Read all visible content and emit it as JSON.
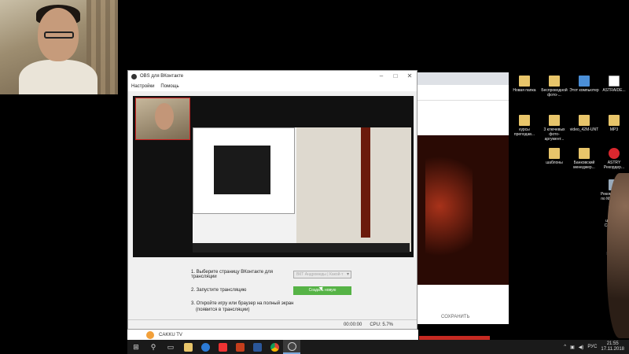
{
  "obs": {
    "title": "OBS для ВКонтакте",
    "menu": [
      "Настройки",
      "Помощь"
    ],
    "step1_label": "1. Выберите страницу ВКонтакте для трансляции",
    "step1_select": "ВКТ Андромеды | Какой-т",
    "step2_label": "2. Запустите трансляцию",
    "step2_button": "Создать новую",
    "step3_label": "3. Откройте игру или браузер на полный экран",
    "step3_note": "(появится в трансляции)",
    "time": "00:00:00",
    "cpu": "CPU: 5.7%"
  },
  "background": {
    "save_label": "СОХРАНИТЬ",
    "channel_name": "CAKKU TV"
  },
  "desktop_icons": [
    {
      "label": "Новая папка",
      "kind": "folder"
    },
    {
      "label": "Беспроводной фото-...",
      "kind": "folder"
    },
    {
      "label": "Этот компьютер",
      "kind": "pc"
    },
    {
      "label": "ASTRAIDE...",
      "kind": "doc"
    },
    {
      "label": "курсы преподав...",
      "kind": "folder"
    },
    {
      "label": "3 ключевых фото-аргумент...",
      "kind": "folder"
    },
    {
      "label": "video_42M-UNT",
      "kind": "folder"
    },
    {
      "label": "MP3",
      "kind": "folder"
    },
    {
      "label": "шаблоны",
      "kind": "folder"
    },
    {
      "label": "Банковский менеджер...",
      "kind": "folder"
    },
    {
      "label": "ASTRY Рекордер...",
      "kind": "red"
    },
    {
      "label": "Рекомендации по MOST ВВ...",
      "kind": "lock"
    },
    {
      "label": "шаблоны Сохранить",
      "kind": "doc"
    },
    {
      "label": "Корзина",
      "kind": "pc"
    }
  ],
  "taskbar": {
    "items": [
      "start-icon",
      "search-icon",
      "task-view-icon",
      "explorer-icon",
      "edge-icon",
      "yandex-icon",
      "powerpoint-icon",
      "word-icon",
      "chrome-icon",
      "obs-icon"
    ],
    "lang": "РУС",
    "time": "21:55",
    "date": "17.11.2018"
  }
}
